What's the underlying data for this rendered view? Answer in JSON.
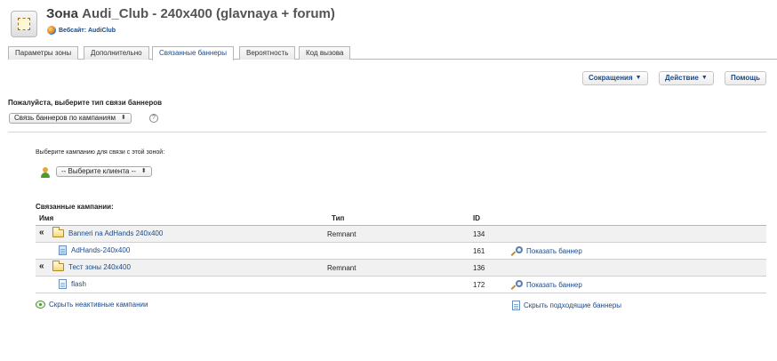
{
  "header": {
    "zone_label": "Зона",
    "zone_name": "Audi_Club - 240x400 (glavnaya + forum)",
    "website_label": "Вебсайт: AudiClub"
  },
  "tabs": [
    {
      "label": "Параметры зоны",
      "active": false
    },
    {
      "label": "Дополнительно",
      "active": false
    },
    {
      "label": "Связанные баннеры",
      "active": true
    },
    {
      "label": "Вероятность",
      "active": false
    },
    {
      "label": "Код вызова",
      "active": false
    }
  ],
  "toolbar": {
    "shortcuts_label": "Сокращения",
    "action_label": "Действие",
    "help_label": "Помощь"
  },
  "link_type": {
    "prompt": "Пожалуйста, выберите тип связи баннеров",
    "selected": "Связь баннеров по кампаниям"
  },
  "campaign_select": {
    "prompt": "Выберите кампанию для связи с этой зоной:",
    "client_selected": "-- Выберите клиента --"
  },
  "linked": {
    "title": "Связанные кампании:",
    "columns": {
      "name": "Имя",
      "type": "Тип",
      "id": "ID"
    },
    "rows": [
      {
        "kind": "campaign",
        "name": "Banneri na AdHands 240x400",
        "type": "Remnant",
        "id": "134"
      },
      {
        "kind": "banner",
        "name": "AdHands-240x400",
        "type": "",
        "id": "161",
        "action": "Показать баннер"
      },
      {
        "kind": "campaign",
        "name": "Тест зоны 240x400",
        "type": "Remnant",
        "id": "136"
      },
      {
        "kind": "banner",
        "name": "flash",
        "type": "",
        "id": "172",
        "action": "Показать баннер"
      }
    ],
    "collapse_glyph": "«"
  },
  "footer": {
    "hide_inactive": "Скрыть неактивные кампании",
    "hide_matching": "Скрыть подходящие баннеры"
  }
}
